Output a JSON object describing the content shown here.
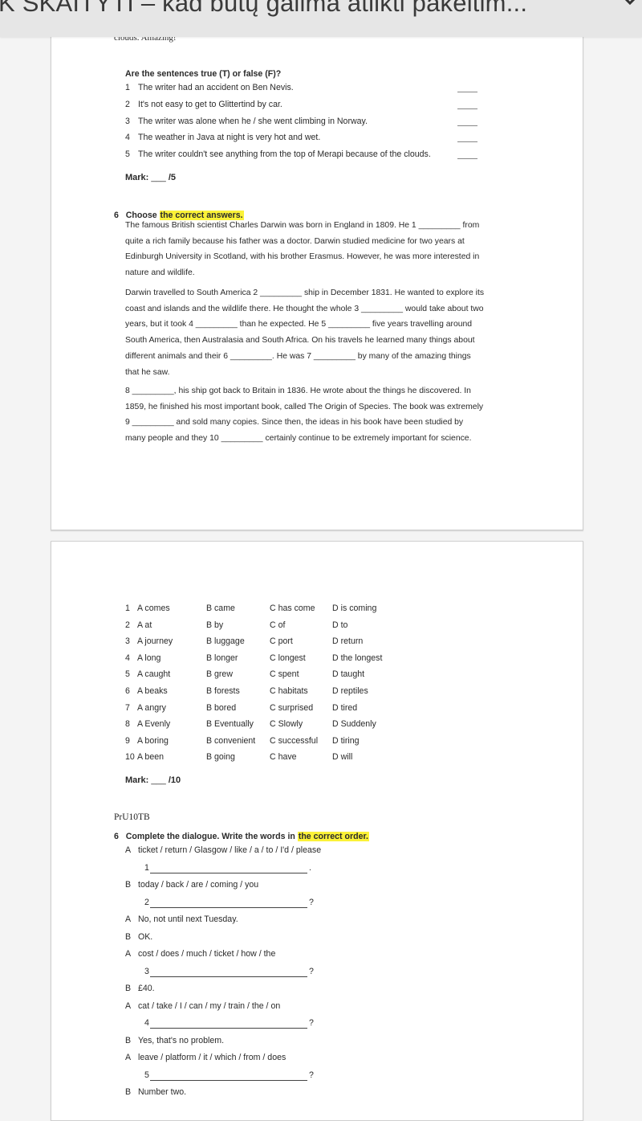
{
  "header": {
    "title": "K SKAITYTI – kad būtų galima atlikti pakeitim...",
    "chevron_icon": "chevron-down-icon"
  },
  "page1": {
    "cut_text": "clouds. Amazing!",
    "tf": {
      "heading": "Are the sentences true (T) or false (F)?",
      "items": [
        {
          "num": "1",
          "text": "The writer had an accident on Ben Nevis.",
          "answer": "____"
        },
        {
          "num": "2",
          "text": "It's not easy to get to Glittertind by car.",
          "answer": "____"
        },
        {
          "num": "3",
          "text": "The writer was alone when he / she went climbing in Norway.",
          "answer": "____"
        },
        {
          "num": "4",
          "text": "The weather in Java at night is very hot and wet.",
          "answer": "____"
        },
        {
          "num": "5",
          "text": "The writer couldn't see anything from the top of Merapi because of the clouds.",
          "answer": "____"
        }
      ],
      "mark_label": "Mark:",
      "mark_blank": "___",
      "mark_total": "/5"
    },
    "ex6": {
      "num": "6",
      "heading_plain": "Choose ",
      "heading_highlight": "the correct answers.",
      "paragraphs": [
        "The famous British scientist Charles Darwin was born in England in 1809. He 1 _________ from quite a rich family because his father was a doctor. Darwin studied medicine for two years at Edinburgh University in Scotland, with his brother Erasmus. However, he was more interested in nature and wildlife.",
        "Darwin travelled to South America 2 _________ ship in December 1831. He wanted to explore its coast and islands and the wildlife there. He thought the whole 3 _________ would take about two years, but it took 4 _________ than he expected. He 5 _________ five years travelling around South America, then Australasia and South Africa. On his travels he learned many things about different animals and their 6 _________. He was 7 _________ by many of the amazing things that he saw.",
        "8 _________, his ship got back to Britain in 1836. He wrote about the things he discovered. In 1859, he finished his most important book, called The Origin of Species. The book was extremely 9 _________ and sold many copies. Since then, the ideas in his book have been studied by many people and they 10 _________ certainly continue to be extremely important for science."
      ],
      "paragraph_lines": [
        [
          "The famous British scientist Charles Darwin was born in England in 1809. He 1 _________ from",
          "quite a rich family because his father was a doctor. Darwin studied medicine for two years at",
          "Edinburgh University in Scotland, with his brother Erasmus. However, he was more interested in",
          "nature and wildlife."
        ],
        [
          "Darwin travelled to South America 2 _________ ship in December 1831. He wanted to explore its",
          "coast and islands and the wildlife there. He thought the whole 3 _________ would take about two",
          "years, but it took 4 _________ than he expected. He 5 _________ five years travelling around",
          "South America, then Australasia and South Africa. On his travels he learned many things about",
          "different animals and their 6 _________. He was 7 _________ by many of the amazing things",
          "that he saw."
        ],
        [
          "8 _________, his ship got back to Britain in 1836. He wrote about the things he discovered. In",
          "1859, he finished his most important book, called The Origin of Species. The book was extremely",
          "9 _________ and sold many copies. Since then, the ideas in his book have been studied by",
          "many people and they 10 _________ certainly continue to be extremely important for science."
        ]
      ]
    }
  },
  "page2": {
    "options": [
      {
        "num": "1",
        "a": "A comes",
        "b": "B came",
        "c": "C has come",
        "d": "D is coming"
      },
      {
        "num": "2",
        "a": "A at",
        "b": "B by",
        "c": "C of",
        "d": "D to"
      },
      {
        "num": "3",
        "a": "A journey",
        "b": "B luggage",
        "c": "C port",
        "d": "D return"
      },
      {
        "num": "4",
        "a": "A long",
        "b": "B longer",
        "c": "C longest",
        "d": "D the longest"
      },
      {
        "num": "5",
        "a": "A caught",
        "b": "B grew",
        "c": "C spent",
        "d": "D taught"
      },
      {
        "num": "6",
        "a": "A beaks",
        "b": "B forests",
        "c": "C habitats",
        "d": "D reptiles"
      },
      {
        "num": "7",
        "a": "A angry",
        "b": "B bored",
        "c": "C surprised",
        "d": "D tired"
      },
      {
        "num": "8",
        "a": " A Evenly",
        "b": "B Eventually",
        "c": "C Slowly",
        "d": "D Suddenly"
      },
      {
        "num": "9",
        "a": "A boring",
        "b": "B convenient",
        "c": "C successful",
        "d": "D tiring"
      },
      {
        "num": "10",
        "a": "A been",
        "b": "B going",
        "c": "C have",
        "d": "D will"
      }
    ],
    "mark_label": "Mark:",
    "mark_blank": "___",
    "mark_total": "/10",
    "code": "PrU10TB",
    "dialogue": {
      "num": "6",
      "heading_plain": "Complete the dialogue. Write the words in ",
      "heading_highlight": "the correct order.",
      "lines": [
        {
          "speaker": "A",
          "text": "ticket / return / Glasgow / like / a / to / I'd / please",
          "answer_num": "1",
          "end": "."
        },
        {
          "speaker": "B",
          "text": "today / back / are / coming / you",
          "answer_num": "2",
          "end": "?"
        },
        {
          "speaker": "A",
          "text": "No, not until next Tuesday."
        },
        {
          "speaker": "B",
          "text": "OK."
        },
        {
          "speaker": "A",
          "text": "cost / does / much / ticket / how / the",
          "answer_num": "3",
          "end": "?"
        },
        {
          "speaker": "B",
          "text": "£40."
        },
        {
          "speaker": "A",
          "text": "cat / take / I / can / my / train / the / on",
          "answer_num": "4",
          "end": "?"
        },
        {
          "speaker": "B",
          "text": "Yes, that's no problem."
        },
        {
          "speaker": "A",
          "text": "leave / platform / it / which / from / does",
          "answer_num": "5",
          "end": "?"
        },
        {
          "speaker": "B",
          "text": "Number two."
        }
      ]
    }
  },
  "colors": {
    "highlight": "#fbf238",
    "topbar_bg": "#e6e6e6",
    "page_bg": "#ffffff",
    "viewer_bg": "#f4f4f4"
  }
}
